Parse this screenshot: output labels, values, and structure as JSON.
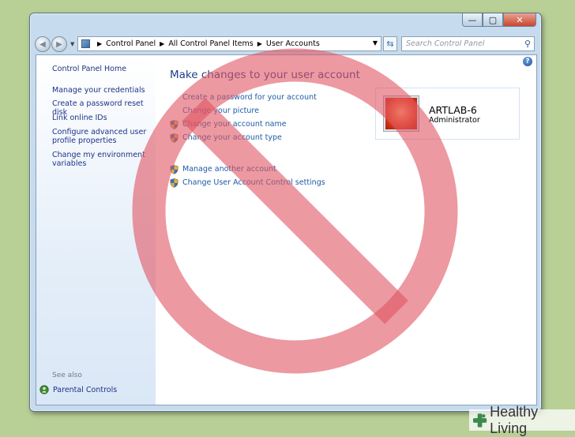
{
  "address_bar": {
    "crumbs": [
      "Control Panel",
      "All Control Panel Items",
      "User Accounts"
    ],
    "search_placeholder": "Search Control Panel"
  },
  "sidebar": {
    "home": "Control Panel Home",
    "items": [
      {
        "label": "Manage your credentials"
      },
      {
        "label": "Create a password reset disk"
      },
      {
        "label": "Link online IDs"
      },
      {
        "label": "Configure advanced user profile properties"
      },
      {
        "label": "Change my environment variables"
      }
    ],
    "see_also": "See also",
    "parental_controls": "Parental Controls"
  },
  "main": {
    "title": "Make changes to your user account",
    "links": [
      {
        "label": "Create a password for your account",
        "shield": false
      },
      {
        "label": "Change your picture",
        "shield": false
      },
      {
        "label": "Change your account name",
        "shield": true
      },
      {
        "label": "Change your account type",
        "shield": true
      },
      {
        "label": "Manage another account",
        "shield": true
      },
      {
        "label": "Change User Account Control settings",
        "shield": true
      }
    ]
  },
  "account": {
    "name": "ARTLAB-6",
    "role": "Administrator"
  },
  "watermark": {
    "brand": "Healthy Living"
  },
  "colors": {
    "window_frame": "#c6dcee",
    "link": "#1e5aa6",
    "no_sign": "#e05563",
    "background": "#b8cf96"
  }
}
